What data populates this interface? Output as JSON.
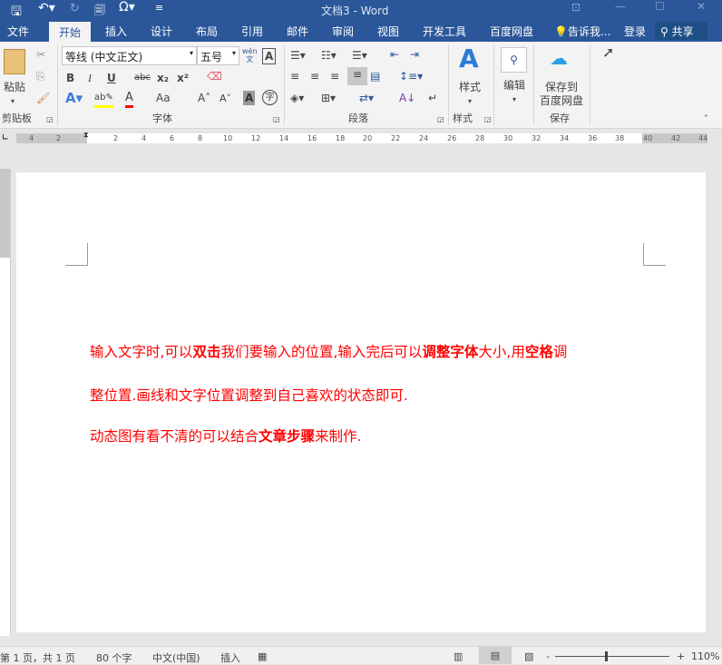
{
  "title": "文档3 - Word",
  "tabs": [
    "文件",
    "开始",
    "插入",
    "设计",
    "布局",
    "引用",
    "邮件",
    "审阅",
    "视图",
    "开发工具",
    "百度网盘"
  ],
  "tell_me": "告诉我...",
  "login": "登录",
  "share": "共享",
  "ribbon": {
    "paste": "粘贴",
    "clipboard": "剪贴板",
    "font_name": "等线 (中文正文)",
    "font_size": "五号",
    "font_group": "字体",
    "paragraph_group": "段落",
    "styles": "样式",
    "styles_group": "样式",
    "edit": "编辑",
    "save_to": "保存到",
    "baidu": "百度网盘",
    "save_group": "保存",
    "wen": "wén",
    "wen_char": "文",
    "bold": "B",
    "italic": "I",
    "underline": "U",
    "strike": "abc",
    "sub": "x₂",
    "sup": "x²",
    "aa": "Aa",
    "zi": "字"
  },
  "ruler": [
    "4",
    "2",
    "2",
    "4",
    "6",
    "8",
    "10",
    "12",
    "14",
    "16",
    "18",
    "20",
    "22",
    "24",
    "26",
    "28",
    "30",
    "32",
    "34",
    "36",
    "38",
    "40",
    "42",
    "44"
  ],
  "document": {
    "lines": [
      [
        {
          "t": "输入文字时,可以",
          "b": false
        },
        {
          "t": "双击",
          "b": true
        },
        {
          "t": "我们要输入的位置,输入完后可以",
          "b": false
        },
        {
          "t": "调整字体",
          "b": true
        },
        {
          "t": "大小,用",
          "b": false
        },
        {
          "t": "空格",
          "b": true
        },
        {
          "t": "调",
          "b": false
        }
      ],
      [
        {
          "t": "整位置.画线和文字位置调整到自己喜欢的状态即可.",
          "b": false
        }
      ],
      [
        {
          "t": "动态图有看不清的可以结合",
          "b": false
        },
        {
          "t": "文章步骤",
          "b": true
        },
        {
          "t": "来制作.",
          "b": false
        }
      ]
    ]
  },
  "status": {
    "page": "第 1 页，共 1 页",
    "words": "80 个字",
    "lang": "中文(中国)",
    "mode": "插入",
    "zoom": "110%",
    "zoom_minus": "-",
    "zoom_plus": "+"
  },
  "colors": {
    "brand": "#2b579a",
    "text": "#ff0000"
  }
}
